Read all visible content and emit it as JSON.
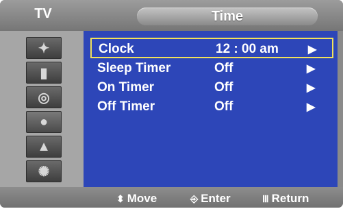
{
  "header": {
    "left_label": "TV",
    "title": "Time"
  },
  "sidebar": {
    "icons": [
      "picture-icon",
      "sound-icon",
      "channel-icon",
      "setup-icon",
      "input-icon",
      "application-icon"
    ]
  },
  "menu": {
    "rows": [
      {
        "label": "Clock",
        "value": "12 : 00 am",
        "arrow": "▶",
        "selected": true
      },
      {
        "label": "Sleep Timer",
        "value": "Off",
        "arrow": "▶"
      },
      {
        "label": "On Timer",
        "value": "Off",
        "arrow": "▶"
      },
      {
        "label": "Off Timer",
        "value": "Off",
        "arrow": "▶"
      }
    ]
  },
  "footer": {
    "move": {
      "glyph": "⬍",
      "label": "Move"
    },
    "enter": {
      "glyph": "⎆",
      "label": "Enter"
    },
    "return": {
      "glyph": "Ⅲ",
      "label": "Return"
    }
  },
  "colors": {
    "content_bg": "#2d46b8",
    "selection": "#f2e25a",
    "frame": "#8a8a8a"
  }
}
